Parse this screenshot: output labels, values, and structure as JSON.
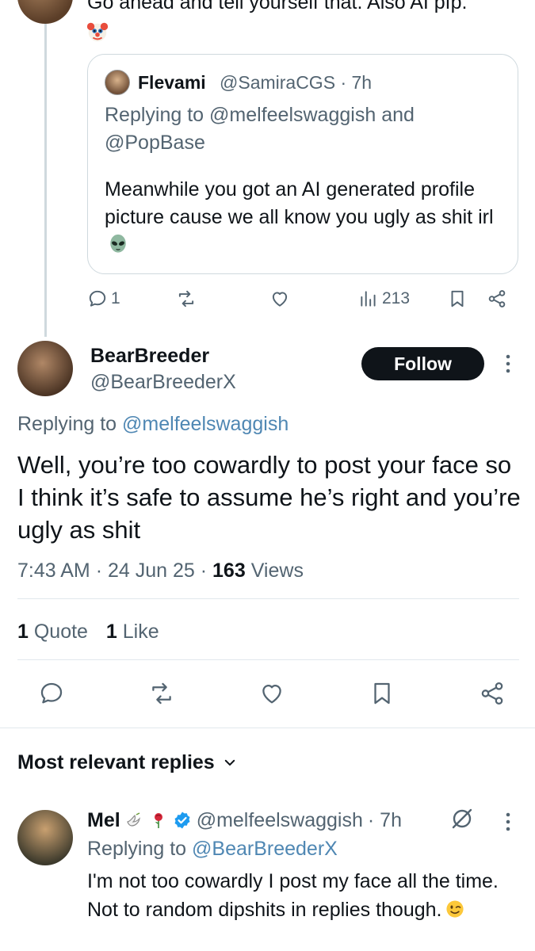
{
  "top_tweet": {
    "text": "Go ahead and tell yourself that. Also AI pfp.",
    "emoji": "clown-face"
  },
  "quoted_tweet": {
    "name": "Flevami",
    "handle": "@SamiraCGS",
    "time": "· 7h",
    "replying_prefix": "Replying to",
    "replying_user1": "@melfeelswaggish",
    "replying_and": "and",
    "replying_user2": "@PopBase",
    "body": "Meanwhile you got an AI generated profile picture cause we all know you ugly as shit irl",
    "body_emoji": "alien"
  },
  "top_actions": {
    "reply_count": "1",
    "views": "213"
  },
  "main_tweet": {
    "name": "BearBreeder",
    "handle": "@BearBreederX",
    "follow_label": "Follow",
    "replying_prefix": "Replying to",
    "replying_user": "@melfeelswaggish",
    "body": "Well, you’re too cowardly to post your face so I think it’s safe to assume he’s right and you’re ugly as shit",
    "time": "7:43 AM",
    "date": "24 Jun 25",
    "views_count": "163",
    "views_label": "Views",
    "quote_count": "1",
    "quote_label": "Quote",
    "like_count": "1",
    "like_label": "Like"
  },
  "sort": {
    "label": "Most relevant replies"
  },
  "reply_tweet": {
    "name": "Mel",
    "handle": "@melfeelswaggish",
    "time": "· 7h",
    "replying_prefix": "Replying to",
    "replying_user": "@BearBreederX",
    "body": "I'm not too cowardly I post my face all the time. Not to random dipshits in replies though.",
    "body_emoji": "winking-face"
  },
  "colors": {
    "text": "#0f1419",
    "muted": "#536471",
    "mention": "#4f87b3",
    "verified": "#1d9bf0",
    "follow_bg": "#0f1419"
  }
}
